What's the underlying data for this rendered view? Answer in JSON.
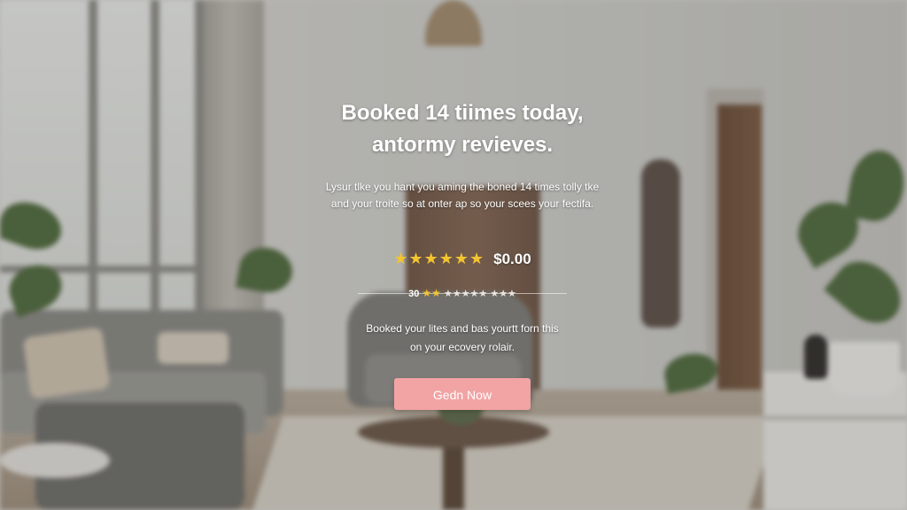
{
  "promo": {
    "headline_line1": "Booked 14 tiimes today,",
    "headline_line2": "antormy revieves.",
    "subtext_line1": "Lysur tlke you hant you aming the boned 14 times tolly tke",
    "subtext_line2": "and your troite so at onter ap so your scees your fectifa.",
    "stars": "★★★★★★",
    "price": "$0.00",
    "divider_count": "30",
    "divider_stars": "★★",
    "divider_text": "★★★★★ ★★★",
    "description_line1": "Booked your lites and bas yourtt forn this",
    "description_line2": "on your ecovery rolair.",
    "cta_label": "Gedn Now"
  },
  "colors": {
    "star": "#f4c430",
    "cta_background": "#f2a3a3",
    "text": "#ffffff"
  },
  "icons": {
    "rating": "star-icon"
  }
}
